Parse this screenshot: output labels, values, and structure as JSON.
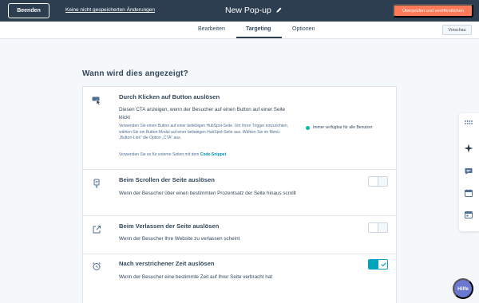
{
  "header": {
    "exit_label": "Beenden",
    "unsaved_label": "Keine nicht gespeicherten Änderungen",
    "title": "New Pop-up",
    "publish_label": "Überprüfen und veröffentlichen"
  },
  "tabs": [
    {
      "label": "Bearbeiten",
      "active": false
    },
    {
      "label": "Targeting",
      "active": true
    },
    {
      "label": "Optionen",
      "active": false
    }
  ],
  "preview_label": "Vorschau",
  "section_heading": "Wann wird dies angezeigt?",
  "triggers": [
    {
      "icon": "cursor-click-icon",
      "title": "Durch Klicken auf Button auslösen",
      "description": "Diesen CTA anzeigen, wenn der Besucher auf einen Button auf einer Seite klickt",
      "help_text": "Verwenden Sie einen Button auf einer beliebigen HubSpot-Seite. Um Ihren Trigger einzurichten, wählen Sie ein Button-Modul auf einer beliebigen HubSpot-Seite aus. Wählen Sie im Menü „Button-Link“ die Option „CTA“ aus.",
      "external_prefix": "Verwenden Sie es für externe Seiten mit dem",
      "external_link": "Code-Snippet",
      "availability": "Immer verfügbar für alle Benutzer"
    },
    {
      "icon": "scroll-icon",
      "title": "Beim Scrollen der Seite auslösen",
      "description": "Wenn der Besucher über einen bestimmten Prozentsatz der Seite hinaus scrollt",
      "enabled": false
    },
    {
      "icon": "exit-icon",
      "title": "Beim Verlassen der Seite auslösen",
      "description": "Wenn der Besucher Ihre Website zu verlassen scheint",
      "enabled": false
    },
    {
      "icon": "alarm-clock-icon",
      "title": "Nach verstrichener Zeit auslösen",
      "description": "Wenn der Besucher eine bestimmte Zeit auf Ihrer Seite verbracht hat",
      "enabled": true
    }
  ],
  "help_label": "Hilfe",
  "colors": {
    "topbar": "#2d3e50",
    "accent_orange": "#ff7a59",
    "toggle_on": "#00a4bd",
    "status_green": "#00bda5",
    "help_purple": "#6a78d1"
  },
  "rail_icons": [
    "grid-dots-icon",
    "sparkle-icon",
    "chat-icon",
    "calendar-icon",
    "calendar-alt-icon"
  ]
}
